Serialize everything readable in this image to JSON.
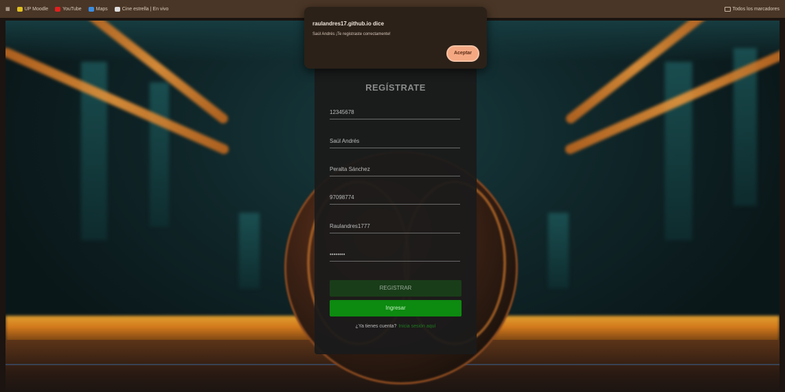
{
  "bookmarks": {
    "items": [
      {
        "label": "UP Moodle",
        "color": "#e0c020"
      },
      {
        "label": "YouTube",
        "color": "#e02020"
      },
      {
        "label": "Maps",
        "color": "#3b8de0"
      },
      {
        "label": "Cine estrella | En vivo",
        "color": "#dddddd"
      }
    ],
    "all_bookmarks": "Todos los marcadores"
  },
  "alert": {
    "origin": "raulandres17.github.io dice",
    "message": "Saúl Andrés ¡Te registraste correctamente!",
    "ok_label": "Aceptar"
  },
  "register": {
    "title": "REGÍSTRATE",
    "fields": [
      {
        "value": "12345678"
      },
      {
        "value": "Saúl Andrés"
      },
      {
        "value": "Peralta Sánchez"
      },
      {
        "value": "97098774"
      },
      {
        "value": "Raulandres1777"
      },
      {
        "value": "••••••••"
      }
    ],
    "register_button": "REGISTRAR",
    "login_button": "Ingresar",
    "footer_text": "¿Ya tienes cuenta?",
    "footer_link": "Inicia sesión aquí"
  }
}
